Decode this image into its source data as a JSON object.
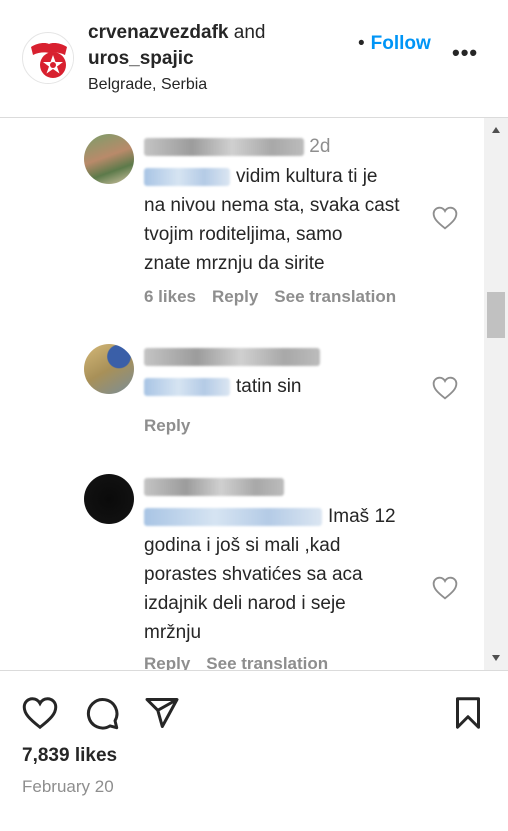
{
  "header": {
    "account1": "crvenazvezdafk",
    "and": "and",
    "account2": "uros_spajic",
    "location": "Belgrade, Serbia",
    "follow_dot": "•",
    "follow_label": "Follow",
    "more_label": "•••"
  },
  "comments": [
    {
      "time": "2d",
      "text_line1": "vidim kultura ti je",
      "text_rest": [
        "na nivou nema sta, svaka cast",
        "tvojim roditeljima, samo",
        "znate mrznju da sirite"
      ],
      "likes": "6 likes",
      "reply": "Reply",
      "translate": "See translation"
    },
    {
      "text_line1": "tatin sin",
      "reply": "Reply"
    },
    {
      "text_line1": "Imaš 12",
      "text_rest": [
        "godina i još si mali ,kad",
        "porastes shvatićes sa aca",
        "izdajnik deli narod i seje",
        "mržnju"
      ],
      "reply": "Reply",
      "translate": "See translation"
    }
  ],
  "post": {
    "likes": "7,839 likes",
    "date": "February 20"
  }
}
